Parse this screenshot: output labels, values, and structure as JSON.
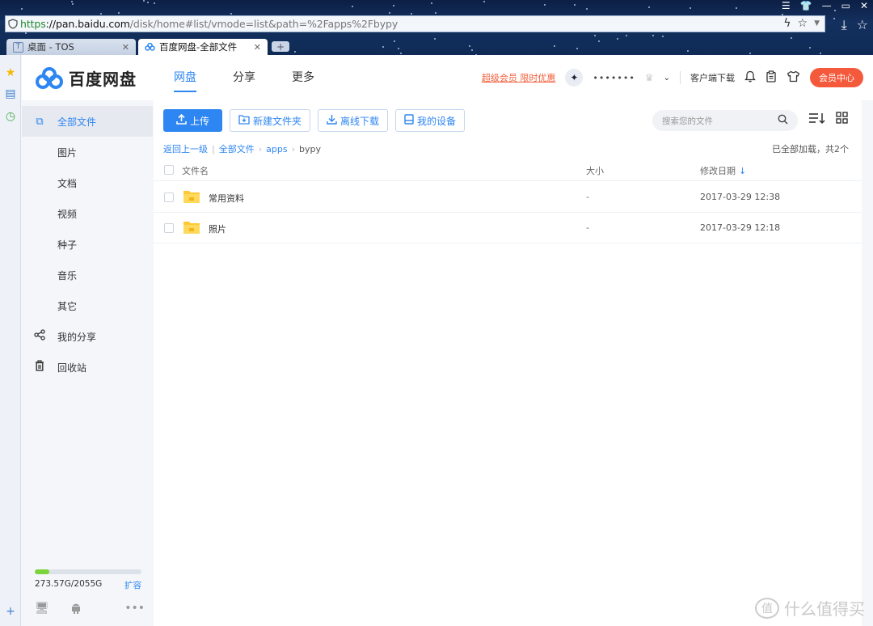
{
  "browser": {
    "url_scheme": "https",
    "url_host": "://pan.baidu.com",
    "url_path": "/disk/home#list/vmode=list&path=%2Fapps%2Fbypy",
    "tabs": [
      {
        "label": "桌面 - TOS",
        "favicon": "T"
      },
      {
        "label": "百度网盘-全部文件",
        "favicon": "baidu-cloud-icon"
      }
    ]
  },
  "header": {
    "brand": "百度网盘",
    "nav": [
      "网盘",
      "分享",
      "更多"
    ],
    "promo": "超级会员 限时优惠",
    "username": "•••••••",
    "client_download": "客户端下载",
    "vip_center": "会员中心"
  },
  "sidebar": {
    "all_files": "全部文件",
    "categories": [
      "图片",
      "文档",
      "视频",
      "种子",
      "音乐",
      "其它"
    ],
    "my_share": "我的分享",
    "recycle": "回收站",
    "quota_text": "273.57G/2055G",
    "quota_used_fraction": 0.133,
    "expand": "扩容"
  },
  "toolbar": {
    "upload": "上传",
    "new_folder": "新建文件夹",
    "offline_download": "离线下载",
    "my_devices": "我的设备",
    "search_placeholder": "搜索您的文件"
  },
  "breadcrumb": {
    "back": "返回上一级",
    "root": "全部文件",
    "level1": "apps",
    "current": "bypy"
  },
  "list_status": "已全部加载，共2个",
  "table": {
    "columns": [
      "文件名",
      "大小",
      "修改日期"
    ],
    "rows": [
      {
        "name": "常用资料",
        "size": "-",
        "date": "2017-03-29 12:38"
      },
      {
        "name": "照片",
        "size": "-",
        "date": "2017-03-29 12:18"
      }
    ]
  },
  "watermark": "什么值得买",
  "colors": {
    "accent": "#2e86f2",
    "vip": "#f5593c",
    "promo": "#f25d3a",
    "quota": "#7ad43a",
    "folder": "#ffc935"
  }
}
